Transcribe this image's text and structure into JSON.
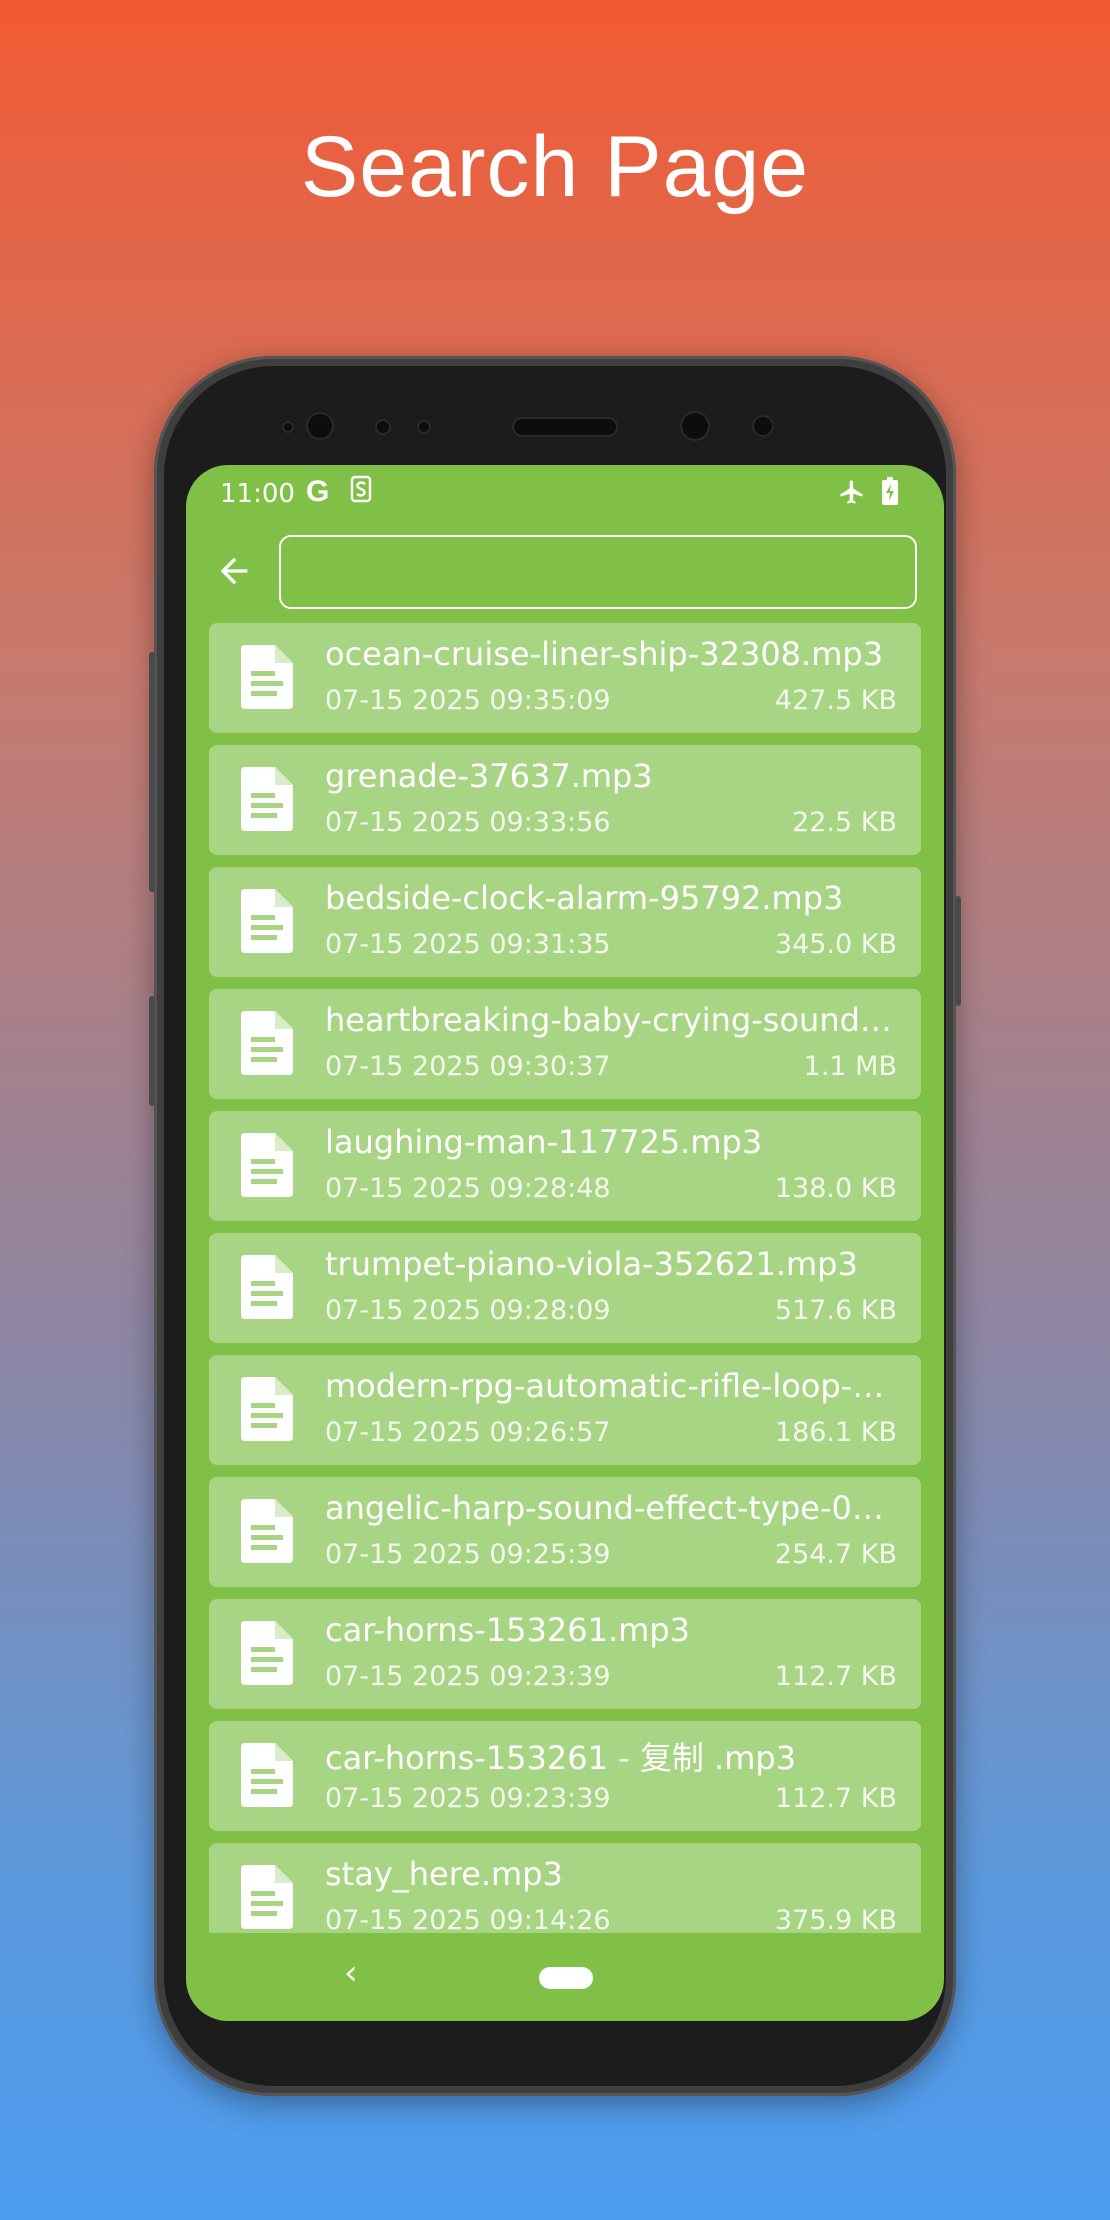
{
  "promo": {
    "title": "Search Page"
  },
  "status_bar": {
    "time": "11:00",
    "g_label": "G"
  },
  "search": {
    "value": "",
    "placeholder": ""
  },
  "files": [
    {
      "name": "ocean-cruise-liner-ship-32308.mp3",
      "date": "07-15 2025 09:35:09",
      "size": "427.5 KB"
    },
    {
      "name": "grenade-37637.mp3",
      "date": "07-15 2025 09:33:56",
      "size": "22.5 KB"
    },
    {
      "name": "bedside-clock-alarm-95792.mp3",
      "date": "07-15 2025 09:31:35",
      "size": "345.0 KB"
    },
    {
      "name": "heartbreaking-baby-crying-sound-ef…",
      "date": "07-15 2025 09:30:37",
      "size": "1.1 MB"
    },
    {
      "name": "laughing-man-117725.mp3",
      "date": "07-15 2025 09:28:48",
      "size": "138.0 KB"
    },
    {
      "name": "trumpet-piano-viola-352621.mp3",
      "date": "07-15 2025 09:28:09",
      "size": "517.6 KB"
    },
    {
      "name": "modern-rpg-automatic-rifle-loop-40…",
      "date": "07-15 2025 09:26:57",
      "size": "186.1 KB"
    },
    {
      "name": "angelic-harp-sound-effect-type-04-2…",
      "date": "07-15 2025 09:25:39",
      "size": "254.7 KB"
    },
    {
      "name": "car-horns-153261.mp3",
      "date": "07-15 2025 09:23:39",
      "size": "112.7 KB"
    },
    {
      "name": "car-horns-153261 - 复制 .mp3",
      "date": "07-15 2025 09:23:39",
      "size": "112.7 KB"
    },
    {
      "name": "stay_here.mp3",
      "date": "07-15 2025 09:14:26",
      "size": "375.9 KB"
    }
  ],
  "navbar": {
    "back_glyph": "‹"
  },
  "icons": {
    "back": "arrow-left-icon",
    "file": "document-icon",
    "status_s": "s-notification-icon",
    "status_plane": "airplane-icon",
    "status_battery": "battery-charging-icon"
  },
  "colors": {
    "screen_bg": "#80c047",
    "item_bg": "#a8d584",
    "text": "#ffffff"
  }
}
